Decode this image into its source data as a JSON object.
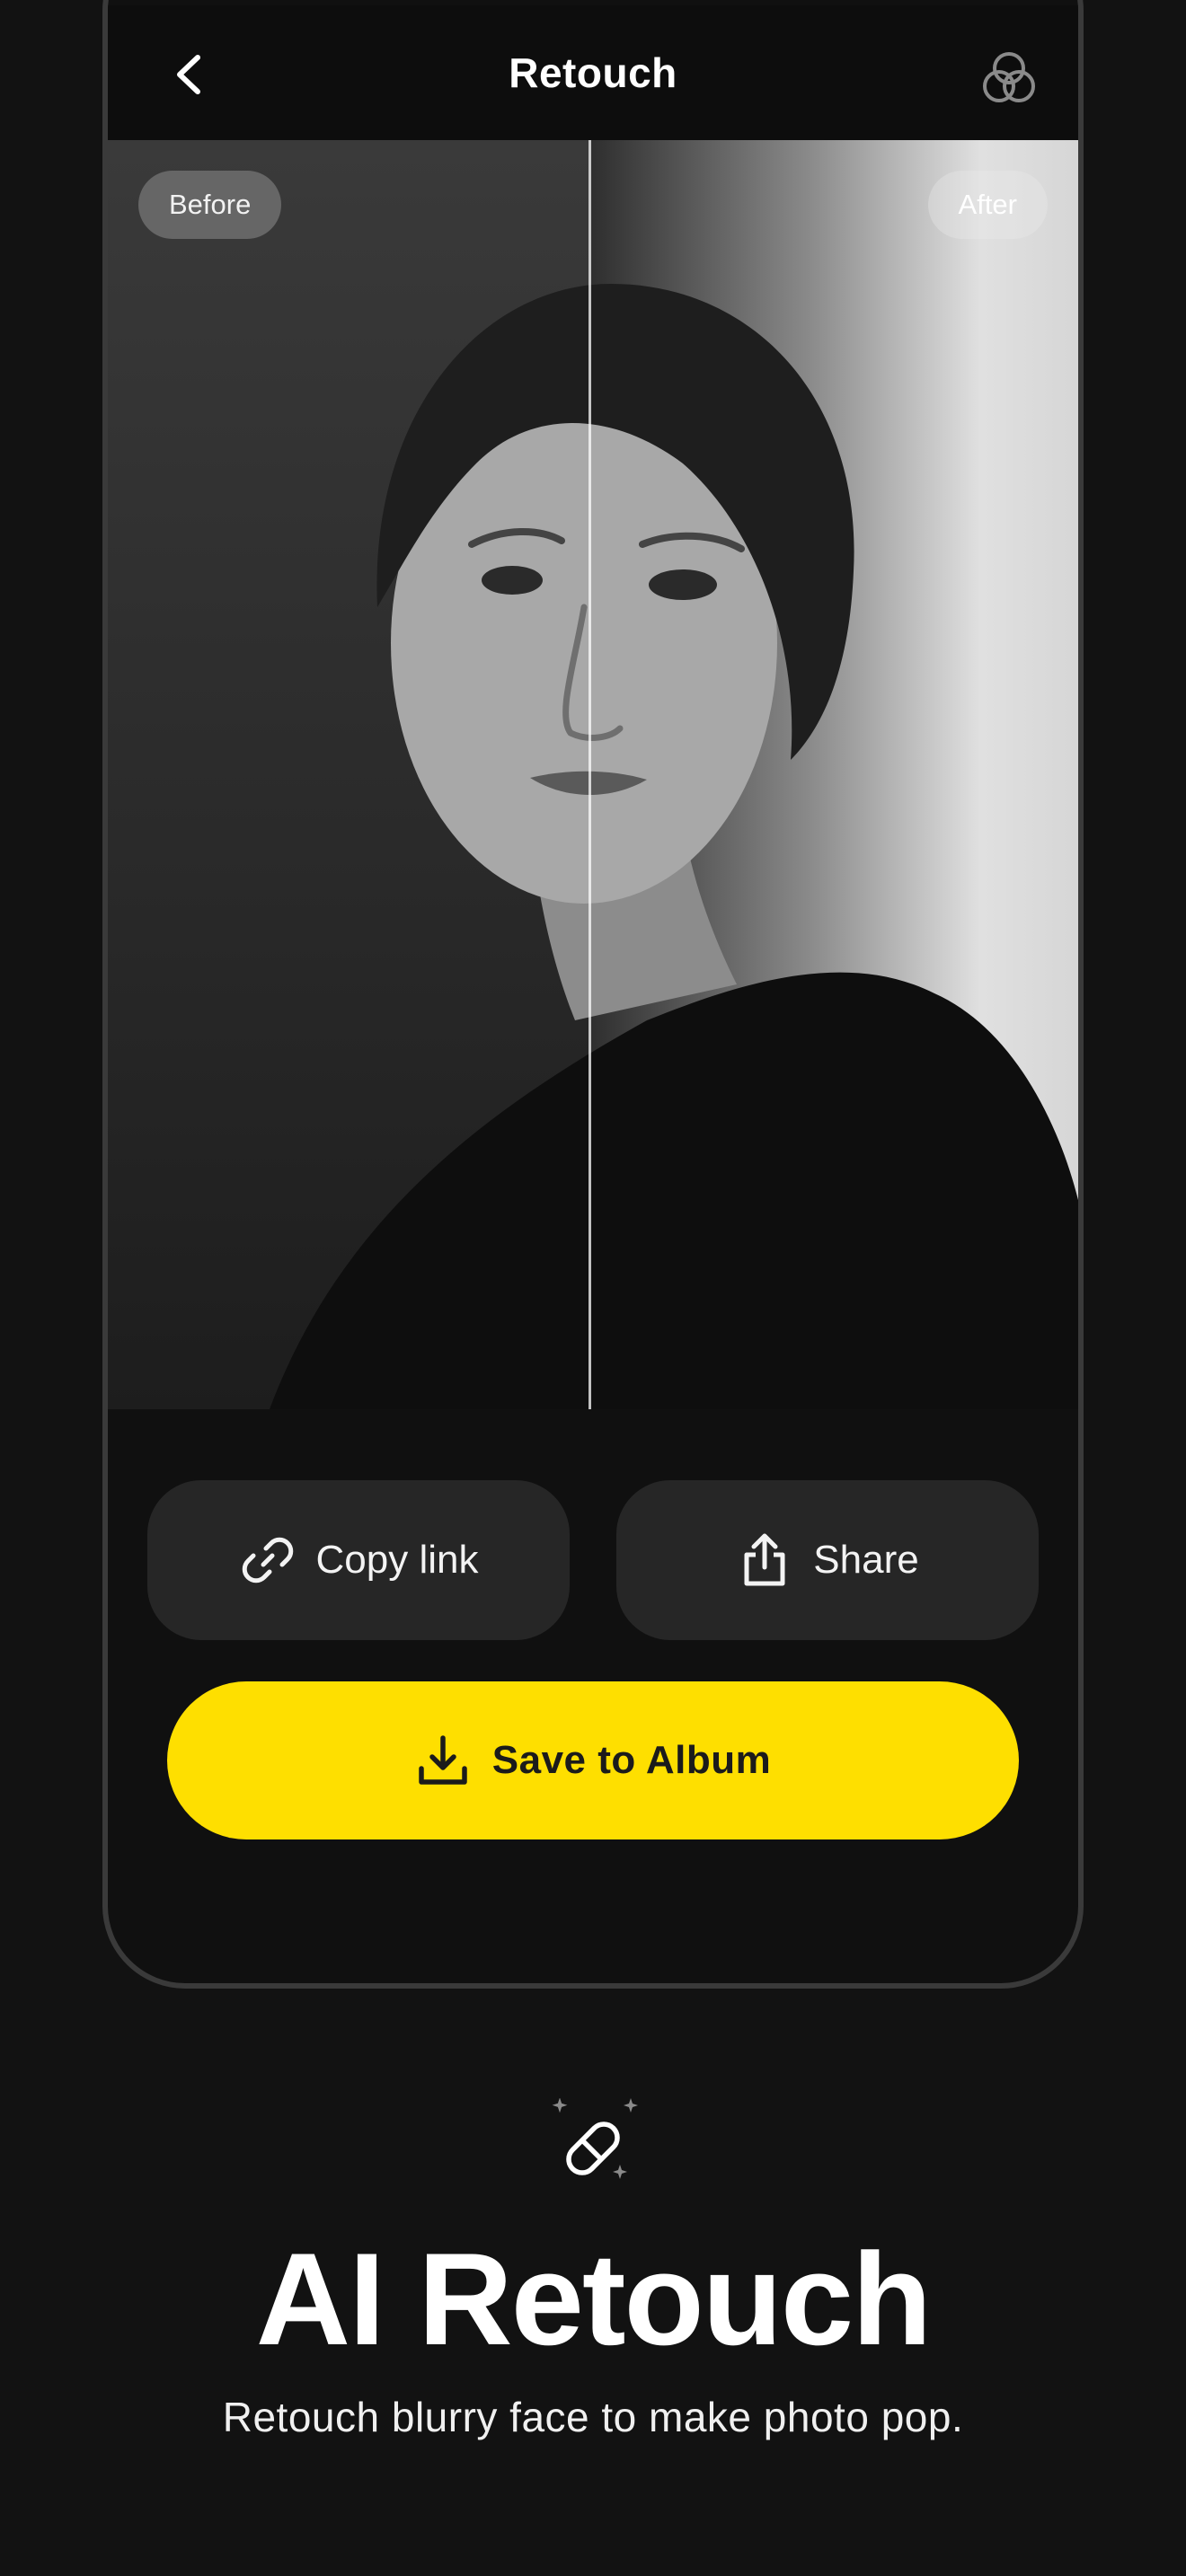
{
  "nav": {
    "title": "Retouch",
    "back_icon": "chevron-left-icon",
    "filters_icon": "overlapping-circles-icon"
  },
  "compare": {
    "before_label": "Before",
    "after_label": "After",
    "image_description": "Black-and-white portrait of a young woman, before/after split"
  },
  "actions": {
    "copy_link_label": "Copy link",
    "copy_link_icon": "link-icon",
    "share_label": "Share",
    "share_icon": "share-icon",
    "save_label": "Save to Album",
    "save_icon": "download-icon"
  },
  "feature": {
    "icon": "magic-eraser-icon",
    "title": "AI Retouch",
    "subtitle": "Retouch blurry face to make photo pop."
  },
  "colors": {
    "background": "#121212",
    "accent": "#fedf00",
    "secondary_button": "#262626"
  }
}
